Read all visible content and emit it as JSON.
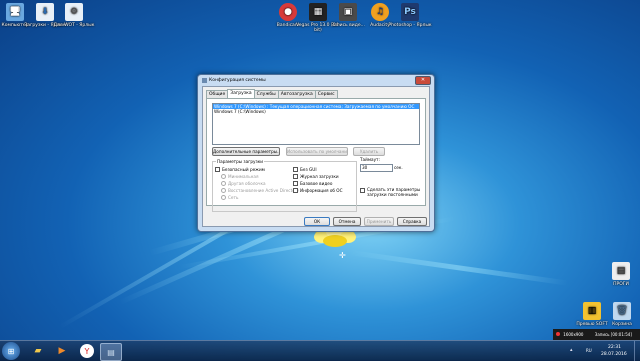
{
  "desktop": {
    "icons": [
      {
        "label": "Компьютер",
        "icon": "computer-icon",
        "color": "#6aa8e0"
      },
      {
        "label": "Загрузки - Ярлык",
        "icon": "downloads-shortcut-icon",
        "color": "#e8f0f8"
      },
      {
        "label": "Для WOT - Ярлык",
        "icon": "folder-shortcut-icon",
        "color": "#e8f0f8"
      },
      {
        "label": "Bandicam",
        "icon": "bandicam-icon",
        "color": "#d83a3a"
      },
      {
        "label": "Vegas Pro 13.0 (64-bit)",
        "icon": "vegas-pro-icon",
        "color": "#222222"
      },
      {
        "label": "Запись виде...",
        "icon": "video-record-icon",
        "color": "#4a4a4a"
      },
      {
        "label": "Audacity",
        "icon": "audacity-icon",
        "color": "#f0a020"
      },
      {
        "label": "Photoshop - Ярлык",
        "icon": "photoshop-icon",
        "color": "#1f3a6e"
      },
      {
        "label": "ПРОГИ",
        "icon": "progi-icon",
        "color": "#eeeeee"
      },
      {
        "label": "Превью SOFT",
        "icon": "preview-soft-icon",
        "color": "#f2c230"
      },
      {
        "label": "Корзина",
        "icon": "recycle-bin-icon",
        "color": "#c0d8ef"
      }
    ]
  },
  "window": {
    "title": "Конфигурация системы",
    "tabs": [
      "Общие",
      "Загрузка",
      "Службы",
      "Автозагрузка",
      "Сервис"
    ],
    "active_tab": 1,
    "os_entries": [
      "Windows 7 (C:\\Windows) : Текущая операционная система; Загружаемая по умолчанию ОС",
      "Windows 7 (C:\\Windows)"
    ],
    "buttons": {
      "advanced": "Дополнительные параметры...",
      "set_default": "Использовать по умолчанию",
      "delete": "Удалить"
    },
    "boot_options": {
      "legend": "Параметры загрузки",
      "safe_boot": "Безопасный режим",
      "minimal": "Минимальная",
      "alternate_shell": "Другая оболочка",
      "ad_repair": "Восстановление Active Directory",
      "network": "Сеть",
      "no_gui": "Без GUI",
      "boot_log": "Журнал загрузки",
      "base_video": "Базовое видео",
      "os_info": "Информация об ОС"
    },
    "timeout": {
      "label": "Таймаут:",
      "value": "30",
      "unit": "сек."
    },
    "permanent": "Сделать эти параметры загрузки постоянными",
    "footer": {
      "ok": "ОК",
      "cancel": "Отмена",
      "apply": "Применить",
      "help": "Справка"
    }
  },
  "taskbar": {
    "language": "RU",
    "time": "22:31",
    "date": "28.07.2016"
  },
  "recording": {
    "resolution": "1600x900",
    "label": "Запись [00:01:54]"
  }
}
